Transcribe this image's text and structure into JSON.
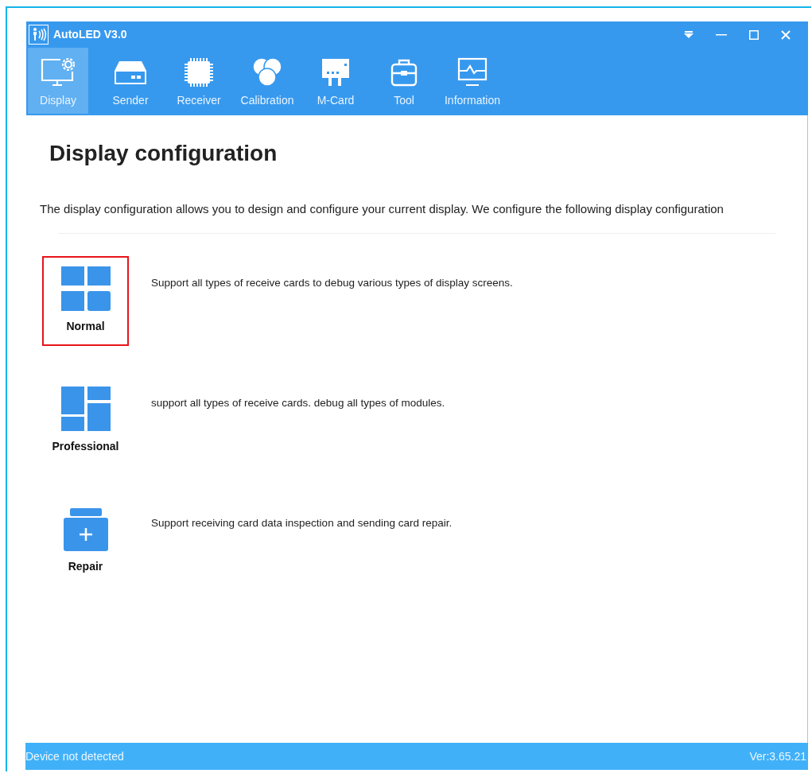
{
  "window": {
    "title": "AutoLED V3.0"
  },
  "toolbar": [
    {
      "label": "Display",
      "kind": "display",
      "selected": true
    },
    {
      "label": "Sender",
      "kind": "sender",
      "selected": false
    },
    {
      "label": "Receiver",
      "kind": "receiver",
      "selected": false
    },
    {
      "label": "Calibration",
      "kind": "calibration",
      "selected": false
    },
    {
      "label": "M-Card",
      "kind": "mcard",
      "selected": false
    },
    {
      "label": "Tool",
      "kind": "tool",
      "selected": false
    },
    {
      "label": "Information",
      "kind": "information",
      "selected": false
    }
  ],
  "heading": "Display configuration",
  "intro": "The display configuration allows you to design and configure your current display. We configure the following display configuration",
  "options": [
    {
      "kind": "normal",
      "label": "Normal",
      "description": "Support all types of receive cards to debug various types of display screens.",
      "selected": true
    },
    {
      "kind": "professional",
      "label": "Professional",
      "description": "support all types of receive cards. debug all types of modules.",
      "selected": false
    },
    {
      "kind": "repair",
      "label": "Repair",
      "description": "Support receiving card data inspection and sending card repair.",
      "selected": false
    }
  ],
  "status_bar": {
    "message": "Device not detected",
    "version": "Ver:3.65.21"
  }
}
